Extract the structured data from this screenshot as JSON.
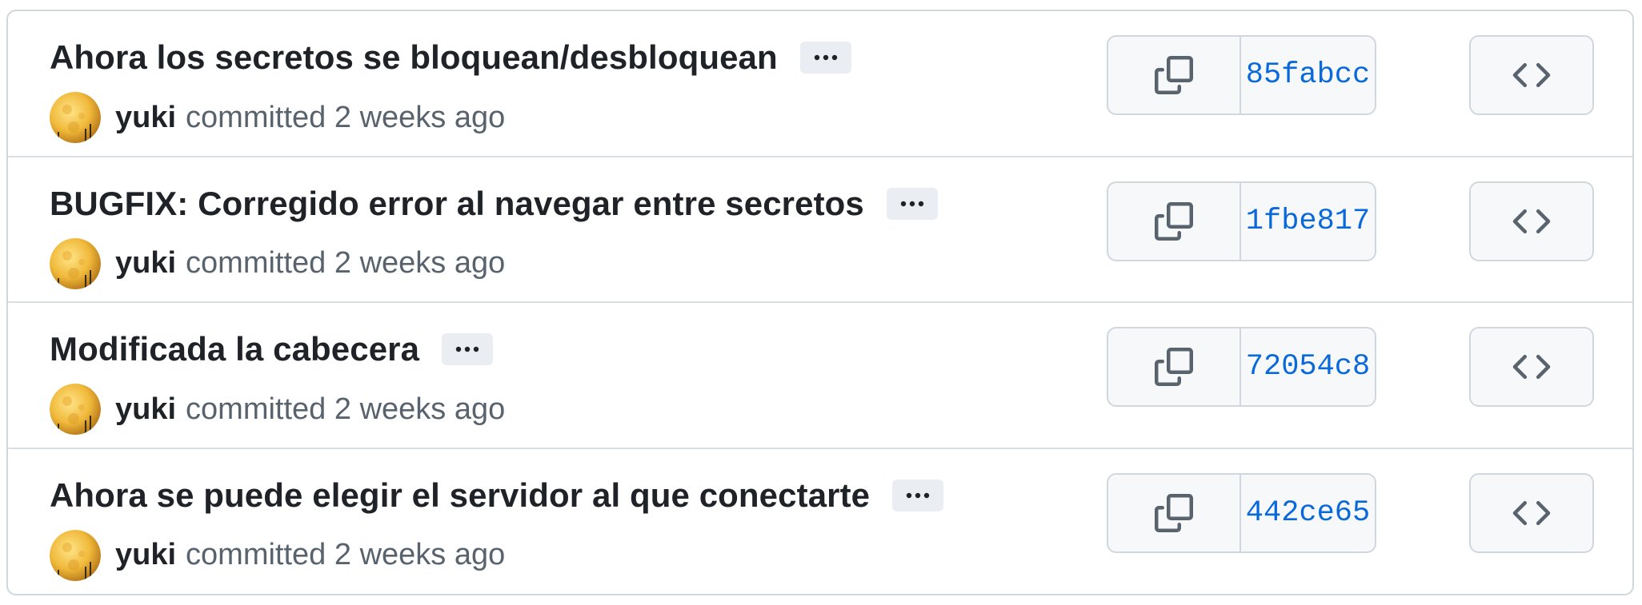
{
  "commits": [
    {
      "title": "Ahora los secretos se bloquean/desbloquean",
      "author": "yuki",
      "meta": "committed 2 weeks ago",
      "sha": "85fabcc"
    },
    {
      "title": "BUGFIX: Corregido error al navegar entre secretos",
      "author": "yuki",
      "meta": "committed 2 weeks ago",
      "sha": "1fbe817"
    },
    {
      "title": "Modificada la cabecera",
      "author": "yuki",
      "meta": "committed 2 weeks ago",
      "sha": "72054c8"
    },
    {
      "title": "Ahora se puede elegir el servidor al que conectarte",
      "author": "yuki",
      "meta": "committed 2 weeks ago",
      "sha": "442ce65"
    }
  ],
  "icons": {
    "ellipsis": "kebab-horizontal-icon",
    "copy": "copy-icon",
    "browse": "code-icon",
    "avatar": "full-moon-avatar"
  },
  "colors": {
    "link": "#0969da",
    "text": "#1f2328",
    "muted": "#59636e",
    "border": "#d0d7de",
    "button_bg": "#f6f8fa"
  }
}
